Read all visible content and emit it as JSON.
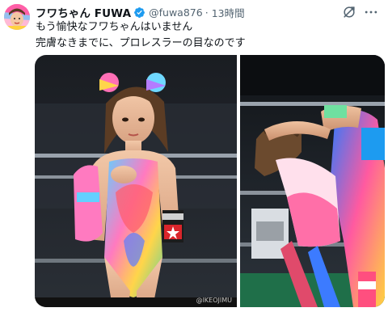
{
  "tweet": {
    "display_name": "フワちゃん FUWA",
    "handle": "@fuwa876",
    "separator": "·",
    "time": "13時間",
    "text_lines": [
      "もう愉快なフワちゃんはいません",
      "完膚なきまでに、プロレスラーの目なのです"
    ],
    "icons": {
      "verified": "verified-badge-icon",
      "grok": "grok-icon",
      "more": "more-options-icon"
    },
    "colors": {
      "verified": "#1d9bf0",
      "secondary_text": "#536471"
    }
  },
  "media": {
    "photo_left_watermark": "@IKEOJIMU"
  }
}
